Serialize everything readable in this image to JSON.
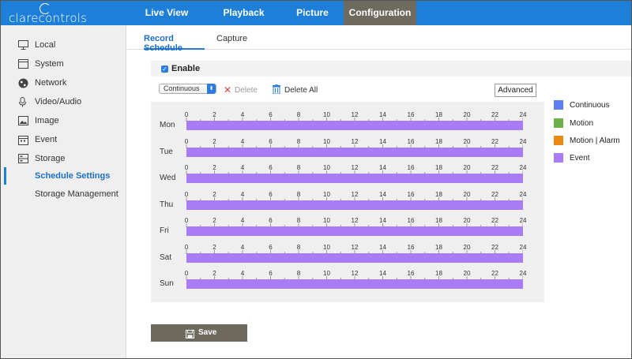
{
  "brand": {
    "logo_text": "clarecontrols"
  },
  "nav": {
    "items": [
      {
        "label": "Live View"
      },
      {
        "label": "Playback"
      },
      {
        "label": "Picture"
      },
      {
        "label": "Configuration",
        "active": true
      }
    ]
  },
  "sidebar": {
    "items": [
      {
        "label": "Local",
        "icon": "monitor-icon"
      },
      {
        "label": "System",
        "icon": "system-icon"
      },
      {
        "label": "Network",
        "icon": "globe-icon"
      },
      {
        "label": "Video/Audio",
        "icon": "microphone-icon"
      },
      {
        "label": "Image",
        "icon": "image-icon"
      },
      {
        "label": "Event",
        "icon": "calendar-icon"
      },
      {
        "label": "Storage",
        "icon": "storage-icon"
      },
      {
        "label": "Schedule Settings",
        "active": true
      },
      {
        "label": "Storage Management"
      }
    ]
  },
  "tabs": [
    {
      "label": "Record Schedule",
      "active": true
    },
    {
      "label": "Capture"
    }
  ],
  "schedule": {
    "enable_label": "Enable",
    "enabled": true,
    "record_type_selected": "Continuous",
    "delete_label": "Delete",
    "delete_all_label": "Delete All",
    "advanced_label": "Advanced",
    "hour_ticks": [
      "0",
      "2",
      "4",
      "6",
      "8",
      "10",
      "12",
      "14",
      "16",
      "18",
      "20",
      "22",
      "24"
    ],
    "days": [
      {
        "label": "Mon",
        "type": "Event",
        "start": 0,
        "end": 24
      },
      {
        "label": "Tue",
        "type": "Event",
        "start": 0,
        "end": 24
      },
      {
        "label": "Wed",
        "type": "Event",
        "start": 0,
        "end": 24
      },
      {
        "label": "Thu",
        "type": "Event",
        "start": 0,
        "end": 24
      },
      {
        "label": "Fri",
        "type": "Event",
        "start": 0,
        "end": 24
      },
      {
        "label": "Sat",
        "type": "Event",
        "start": 0,
        "end": 24
      },
      {
        "label": "Sun",
        "type": "Event",
        "start": 0,
        "end": 24
      }
    ]
  },
  "legend": [
    {
      "label": "Continuous",
      "color": "#5b7ff0"
    },
    {
      "label": "Motion",
      "color": "#6cb04a"
    },
    {
      "label": "Motion | Alarm",
      "color": "#ea8a14"
    },
    {
      "label": "Event",
      "color": "#a97cf6"
    }
  ],
  "save_label": "Save"
}
